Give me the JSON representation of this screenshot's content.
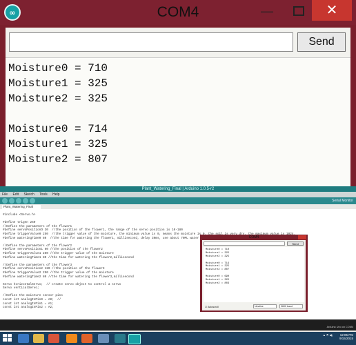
{
  "zoom": {
    "title": "COM4",
    "logo_glyph": "∞",
    "min_glyph": "—",
    "close_glyph": "✕",
    "send_label": "Send",
    "input_value": "",
    "lines": [
      "Moisture0 = 710",
      "Moisture1 = 325",
      "Moisture2 = 325",
      "",
      "Moisture0 = 714",
      "Moisture1 = 325",
      "Moisture2 = 807"
    ]
  },
  "ide": {
    "title": "Plant_Watering_Final | Arduino 1.0.5-r2",
    "menu": [
      "File",
      "Edit",
      "Sketch",
      "Tools",
      "Help"
    ],
    "serial_monitor_label": "Serial Monitor",
    "tab_label": "Plant_Watering_Final",
    "code_lines": [
      "#include <Servo.h>",
      "",
      "#define trigen 250",
      "//Define the parameters of the flower1",
      "#define servoPositionO 30  //the position of the flower1, the range of the servo position is 10-180",
      "#define triggerValue0 250  //the trigger value of the moisture, the minimum value is 0, means the moisture is 0, the soil is very dry. the maximum value is 1024.",
      "#define wateringTime0 80  //the time for watering the flower1, millisecond, delay 30ms, use about 70ML water",
      "",
      "//Define the parameters of the flower2",
      "#define servoPosition1 60 //the position of the flower2",
      "#define triggerValue1 250 //the trigger value of the moisture",
      "#define wateringTime1 80 //the time for watering the flower2,millisecond",
      "",
      "//Define the parameters of the flower3",
      "#define servoPosition2 120 //the position of the flower3",
      "#define triggerValue2 250 //the trigger value of the moisture",
      "#define wateringTime2 80 //the time for watering the flower3,millisecond",
      "",
      "Servo horizontalServo;  // create servo object to control a servo",
      "Servo verticalServo;",
      "",
      "//Define the moisture sensor pins",
      "const int analogInPin0 = A0;  //",
      "const int analogInPin1 = A1;",
      "const int analogInPin2 = A2;"
    ],
    "status_line": "Arduino Uno on COM4"
  },
  "mini": {
    "title": "COM4",
    "send_label": "Send",
    "lines": [
      "Moisture0 = 710",
      "Moisture1 = 325",
      "Moisture2 = 325",
      "",
      "Moisture0 = 714",
      "Moisture1 = 325",
      "Moisture2 = 807",
      "",
      "Moisture0 = 690",
      "Moisture1 = 325",
      "Moisture2 = 803"
    ],
    "autoscroll_label": "Autoscroll",
    "line_ending": "Newline",
    "baud": "9600 baud"
  },
  "taskbar": {
    "time": "12:05 PM",
    "date": "9/15/2015"
  },
  "colors": {
    "window_frame": "#7a1f2c",
    "close_button": "#c7362f",
    "arduino_teal": "#2b8a8e",
    "taskbar": "#1b3f5e"
  }
}
